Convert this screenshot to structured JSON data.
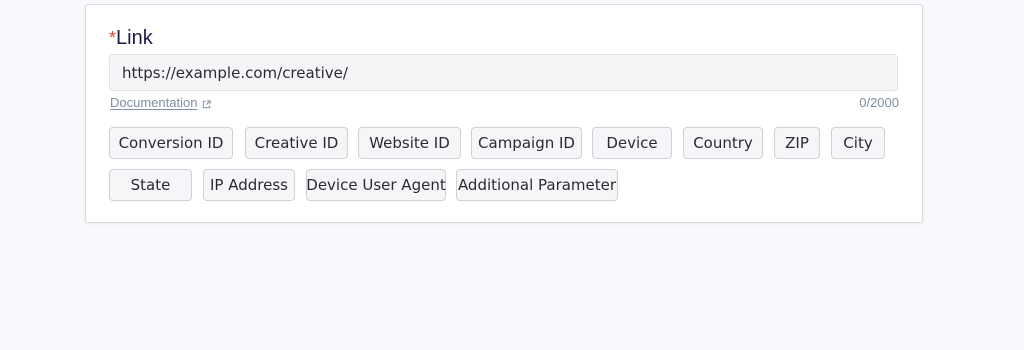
{
  "field": {
    "required_mark": "*",
    "label": "Link",
    "value": "https://example.com/creative/",
    "documentation_link": "Documentation",
    "counter": "0/2000"
  },
  "parameters": [
    "Conversion ID",
    "Creative ID",
    "Website ID",
    "Campaign ID",
    "Device",
    "Country",
    "ZIP",
    "City",
    "State",
    "IP Address",
    "Device User Agent",
    "Additional Parameter"
  ],
  "icons": {
    "documentation": "external-link-icon"
  },
  "colors": {
    "required": "#e0453f",
    "label": "#1c1a4a",
    "muted_link": "#7f8ea3"
  }
}
